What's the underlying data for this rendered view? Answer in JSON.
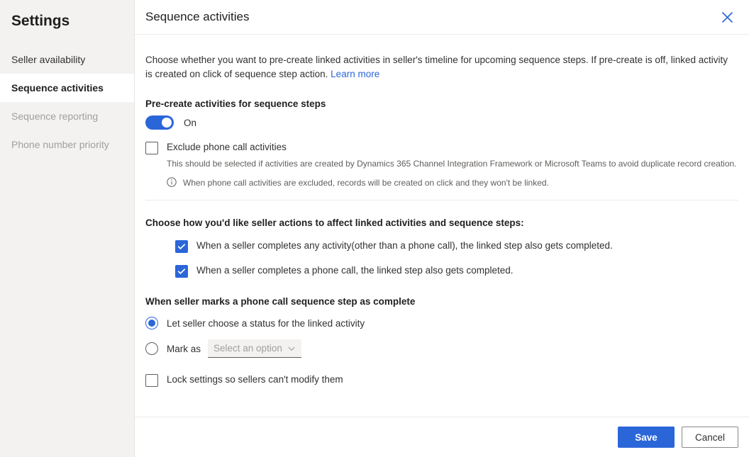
{
  "sidebar": {
    "title": "Settings",
    "items": [
      {
        "label": "Seller availability",
        "state": "normal"
      },
      {
        "label": "Sequence activities",
        "state": "active"
      },
      {
        "label": "Sequence reporting",
        "state": "disabled"
      },
      {
        "label": "Phone number priority",
        "state": "disabled"
      }
    ]
  },
  "panel": {
    "title": "Sequence activities",
    "close_icon": "close-icon",
    "description": "Choose whether you want to pre-create linked activities in seller's timeline for upcoming sequence steps. If pre-create is off, linked activity is created on click of sequence step action.",
    "learn_more": "Learn more"
  },
  "precreate": {
    "label": "Pre-create activities for sequence steps",
    "toggle_state": "On",
    "toggle_on": true
  },
  "exclude": {
    "label": "Exclude phone call activities",
    "checked": false,
    "description": "This should be selected if activities are created by Dynamics 365 Channel Integration Framework or Microsoft Teams to avoid duplicate record creation.",
    "info_icon": "info-icon",
    "info_text": "When phone call activities are excluded, records will be created on click and they won't be linked."
  },
  "seller_actions": {
    "heading": "Choose how you'd like seller actions to affect linked activities and sequence steps:",
    "options": [
      {
        "label": "When a seller completes any activity(other than a phone call), the linked step also gets completed.",
        "checked": true
      },
      {
        "label": "When a seller completes a phone call, the linked step also gets completed.",
        "checked": true
      }
    ]
  },
  "phone_complete": {
    "heading": "When seller marks a phone call sequence step as complete",
    "option_let_seller": "Let seller choose a status for the linked activity",
    "option_mark_as": "Mark as",
    "selected": "let_seller",
    "dropdown_placeholder": "Select an option",
    "dropdown_icon": "chevron-down-icon"
  },
  "lock": {
    "label": "Lock settings so sellers can't modify them",
    "checked": false
  },
  "footer": {
    "save_label": "Save",
    "cancel_label": "Cancel"
  },
  "colors": {
    "accent": "#2b66d9",
    "sidebar_bg": "#f3f2f1",
    "divider": "#edebe9"
  }
}
